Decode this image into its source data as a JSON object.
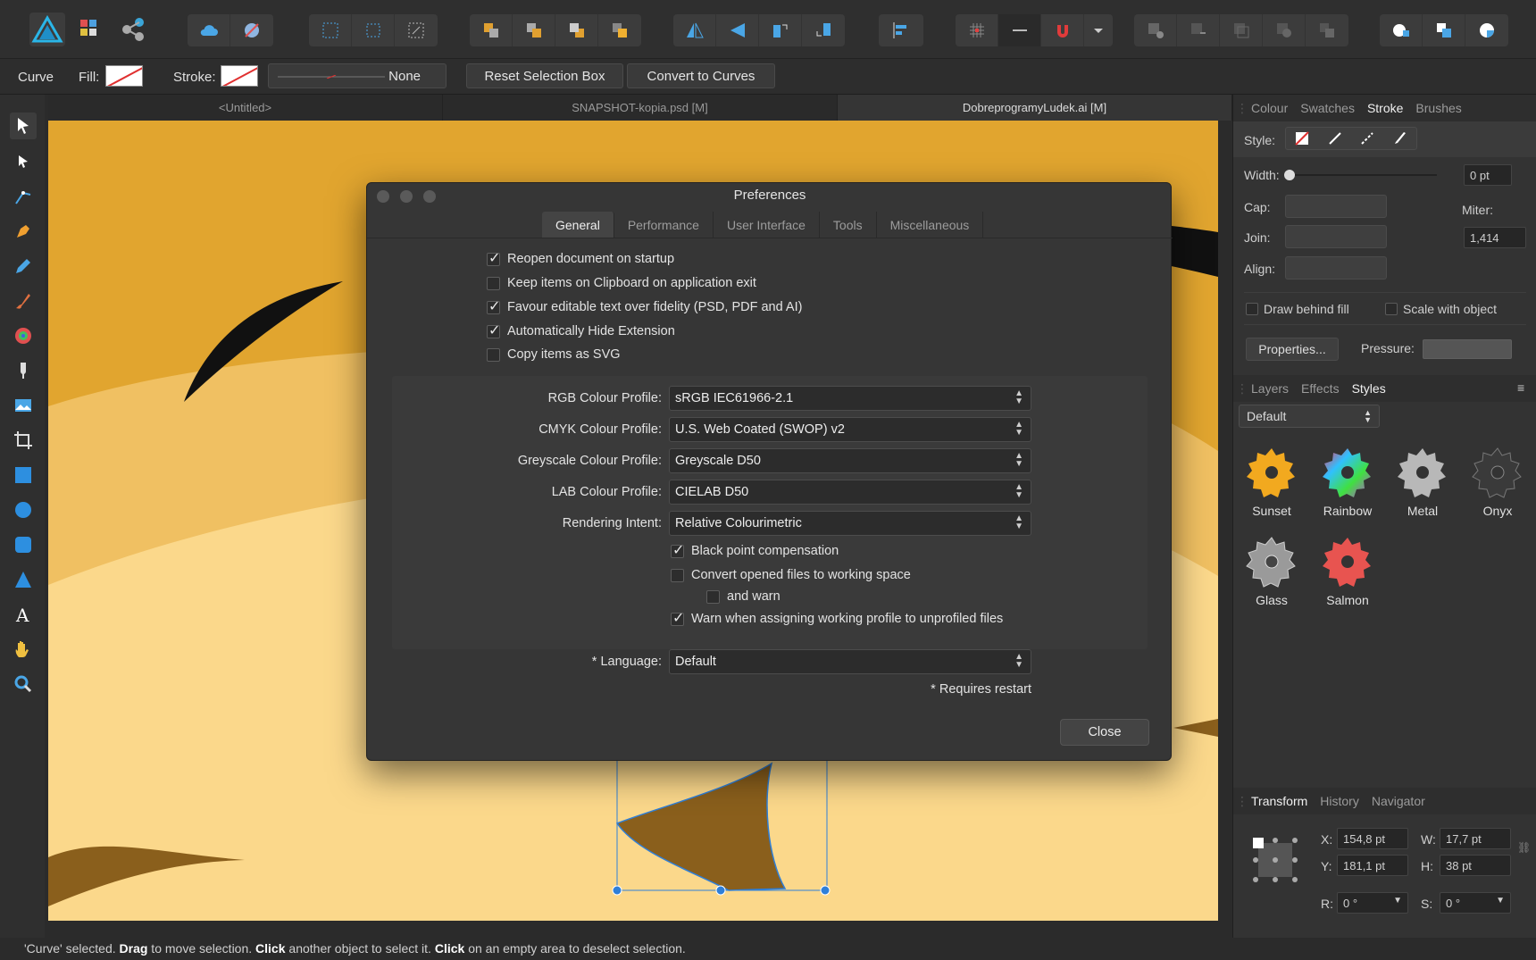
{
  "context_bar": {
    "tool_name": "Curve",
    "fill_label": "Fill:",
    "stroke_label": "Stroke:",
    "stroke_style_value": "None",
    "reset_button": "Reset Selection Box",
    "convert_button": "Convert to Curves"
  },
  "doc_tabs": [
    {
      "label": "<Untitled>"
    },
    {
      "label": "SNAPSHOT-kopia.psd [M]"
    },
    {
      "label": "DobreprogramyLudek.ai [M]"
    }
  ],
  "stroke_panel": {
    "tabs": [
      "Colour",
      "Swatches",
      "Stroke",
      "Brushes"
    ],
    "active_tab": "Stroke",
    "style_label": "Style:",
    "width_label": "Width:",
    "width_value": "0 pt",
    "cap_label": "Cap:",
    "join_label": "Join:",
    "align_label": "Align:",
    "miter_label": "Miter:",
    "miter_value": "1,414",
    "draw_behind_fill": "Draw behind fill",
    "scale_with_object": "Scale with object",
    "properties_button": "Properties...",
    "pressure_label": "Pressure:"
  },
  "styles_panel": {
    "tabs": [
      "Layers",
      "Effects",
      "Styles"
    ],
    "active_tab": "Styles",
    "category": "Default",
    "items": [
      {
        "label": "Sunset",
        "color": "#f2a91f"
      },
      {
        "label": "Rainbow",
        "color": "#c04bd8"
      },
      {
        "label": "Metal",
        "color": "#b8b8b8"
      },
      {
        "label": "Onyx",
        "color": "#3a3a3a"
      },
      {
        "label": "Glass",
        "color": "#9a9a9a"
      },
      {
        "label": "Salmon",
        "color": "#e85450"
      }
    ]
  },
  "transform_panel": {
    "tabs": [
      "Transform",
      "History",
      "Navigator"
    ],
    "active_tab": "Transform",
    "x_label": "X:",
    "x_value": "154,8 pt",
    "y_label": "Y:",
    "y_value": "181,1 pt",
    "w_label": "W:",
    "w_value": "17,7 pt",
    "h_label": "H:",
    "h_value": "38 pt",
    "r_label": "R:",
    "r_value": "0 °",
    "s_label": "S:",
    "s_value": "0 °"
  },
  "dialog": {
    "title": "Preferences",
    "tabs": [
      "General",
      "Performance",
      "User Interface",
      "Tools",
      "Miscellaneous"
    ],
    "active_tab": "General",
    "options": [
      {
        "label": "Reopen document on startup",
        "checked": true
      },
      {
        "label": "Keep items on Clipboard on application exit",
        "checked": false
      },
      {
        "label": "Favour editable text over fidelity (PSD, PDF and AI)",
        "checked": true
      },
      {
        "label": "Automatically Hide Extension",
        "checked": true
      },
      {
        "label": "Copy items as SVG",
        "checked": false
      }
    ],
    "profiles": [
      {
        "label": "RGB Colour Profile:",
        "value": "sRGB IEC61966-2.1"
      },
      {
        "label": "CMYK Colour Profile:",
        "value": "U.S. Web Coated (SWOP) v2"
      },
      {
        "label": "Greyscale Colour Profile:",
        "value": "Greyscale D50"
      },
      {
        "label": "LAB Colour Profile:",
        "value": "CIELAB D50"
      },
      {
        "label": "Rendering Intent:",
        "value": "Relative Colourimetric"
      }
    ],
    "colour_options": [
      {
        "label": "Black point compensation",
        "checked": true
      },
      {
        "label": "Convert opened files to working space",
        "checked": false
      },
      {
        "label": "and warn",
        "checked": false
      },
      {
        "label": "Warn when assigning working profile to unprofiled files",
        "checked": true
      }
    ],
    "language_label": "* Language:",
    "language_value": "Default",
    "restart_note": "* Requires restart",
    "close_button": "Close"
  },
  "status": {
    "part1": "'Curve' selected. ",
    "bold1": "Drag",
    "part2": " to move selection. ",
    "bold2": "Click",
    "part3": " another object to select it. ",
    "bold3": "Click",
    "part4": " on an empty area to deselect selection."
  },
  "colors": {
    "accent": "#2f7fd8",
    "canvas_orange": "#e1a52f",
    "canvas_sand": "#fbd88b"
  }
}
